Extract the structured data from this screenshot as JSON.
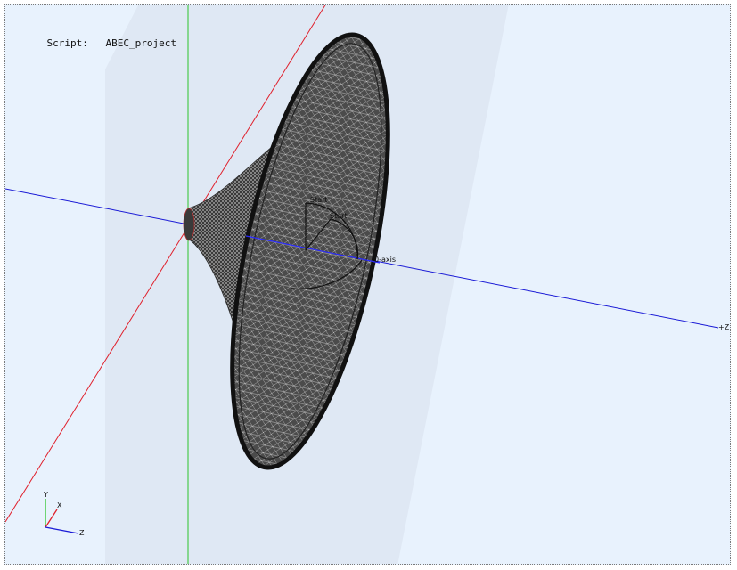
{
  "viewport": {
    "script_label": "Script:",
    "script_name": "ABEC_project"
  },
  "scene": {
    "axis_label_z": "+Z",
    "annotation_0_axis": "0-axis",
    "annotation_start": "Start",
    "annotation_start2": "Start",
    "colors": {
      "background": "#e8f2fd",
      "panel": "#dfe8f4",
      "x_axis": "#e0202c",
      "y_axis": "#2cc52c",
      "z_axis": "#1a1ad6",
      "mesh_fill": "#4a4a4a",
      "mesh_line": "#d8d8d8"
    }
  },
  "gizmo": {
    "label_y": "Y",
    "label_x": "X",
    "label_z": "Z"
  }
}
